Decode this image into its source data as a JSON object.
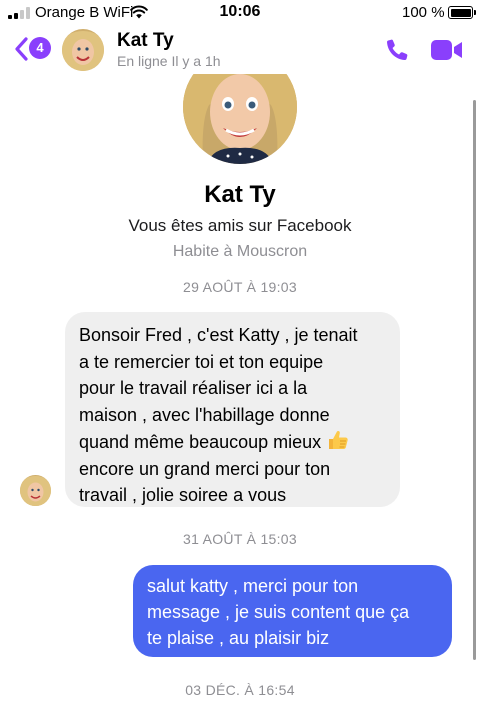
{
  "status_bar": {
    "carrier": "Orange B WiFi",
    "time": "10:06",
    "battery": "100 %",
    "battery_level": 1.0
  },
  "header": {
    "back_badge": "4",
    "contact_name": "Kat Ty",
    "contact_status": "En ligne Il y a 1h",
    "icons": {
      "back": "chevron-left-icon",
      "call": "phone-icon",
      "video": "video-camera-icon"
    }
  },
  "profile": {
    "name": "Kat Ty",
    "friends_text": "Vous êtes amis sur Facebook",
    "location": "Habite à Mouscron"
  },
  "messages": [
    {
      "type": "timestamp",
      "text": "29 AOÛT À 19:03"
    },
    {
      "type": "received",
      "lines": [
        "Bonsoir Fred , c'est Katty , je tenait",
        "a te remercier toi et ton equipe",
        "pour le travail réaliser ici a la",
        "maison , avec l'habillage donne",
        "quand même beaucoup mieux",
        "encore un grand merci pour ton",
        "travail , jolie soiree a vous"
      ],
      "emoji": "thumbs-up-icon"
    },
    {
      "type": "timestamp",
      "text": "31 AOÛT À 15:03"
    },
    {
      "type": "sent",
      "lines": [
        "salut katty , merci pour ton",
        "message , je suis content que ça",
        "te plaise , au plaisir biz"
      ]
    },
    {
      "type": "timestamp",
      "text": "03 DÉC. À 16:54"
    }
  ],
  "colors": {
    "accent": "#8a3ffc",
    "sent_bubble": "#4a66f0",
    "received_bubble": "#efefef",
    "meta_text": "#8e8e93"
  }
}
